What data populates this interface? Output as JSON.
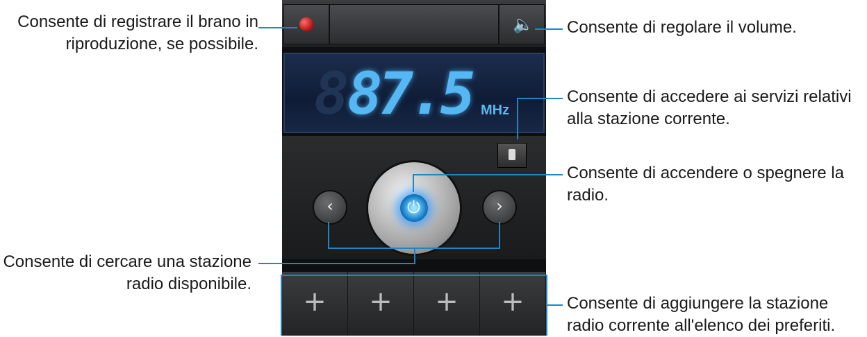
{
  "annotations": {
    "record": [
      "Consente di registrare il brano in",
      "riproduzione, se possibile."
    ],
    "volume": [
      "Consente di regolare il volume."
    ],
    "rds": [
      "Consente di accedere ai servizi relativi",
      "alla stazione corrente."
    ],
    "power": [
      "Consente di accendere o spegnere la",
      "radio."
    ],
    "search": [
      "Consente di cercare una stazione",
      "radio disponibile."
    ],
    "favorites": [
      "Consente di aggiungere la stazione",
      "radio corrente all'elenco dei preferiti."
    ]
  },
  "radio": {
    "frequency": "87.5",
    "unit": "MHz",
    "seek_prev": "‹",
    "seek_next": "›",
    "favorites": [
      "+",
      "+",
      "+",
      "+"
    ]
  },
  "icons": {
    "record": "record-icon",
    "volume": "speaker-icon",
    "rds": "lock-icon",
    "power": "power-icon",
    "prev": "chevron-left-icon",
    "next": "chevron-right-icon",
    "add": "plus-icon"
  },
  "colors": {
    "leader": "#1f86c4",
    "display_digits": "#56b8f2",
    "record": "#c8141a"
  }
}
